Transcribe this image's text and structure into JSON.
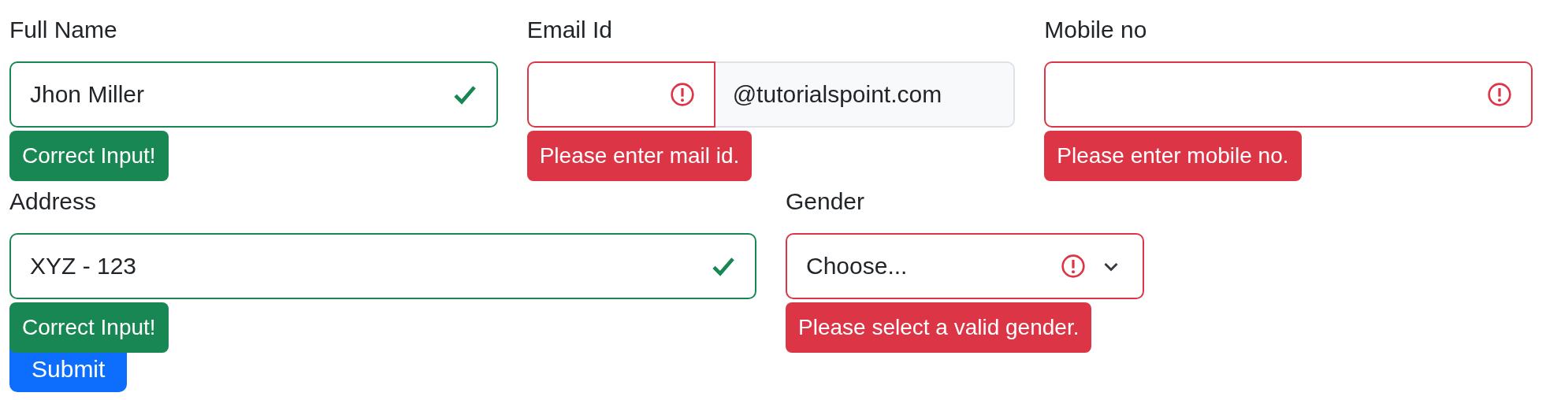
{
  "fields": [
    {
      "label": "Full Name",
      "kind": "text",
      "value": "Jhon Miller",
      "valid": true,
      "feedback": "Correct Input!"
    },
    {
      "label": "Email Id",
      "kind": "addon",
      "addon": "@tutorialspoint.com",
      "valid": false,
      "feedback": "Please enter mail id."
    },
    {
      "label": "Mobile no",
      "kind": "text",
      "valid": false,
      "feedback": "Please enter mobile no."
    },
    {
      "label": "Address",
      "kind": "text",
      "value": "XYZ - 123",
      "valid": true,
      "feedback": "Correct Input!"
    },
    {
      "label": "Gender",
      "kind": "select",
      "value": "Choose...",
      "valid": false,
      "feedback": "Please select a valid gender."
    }
  ],
  "submit": "Submit"
}
